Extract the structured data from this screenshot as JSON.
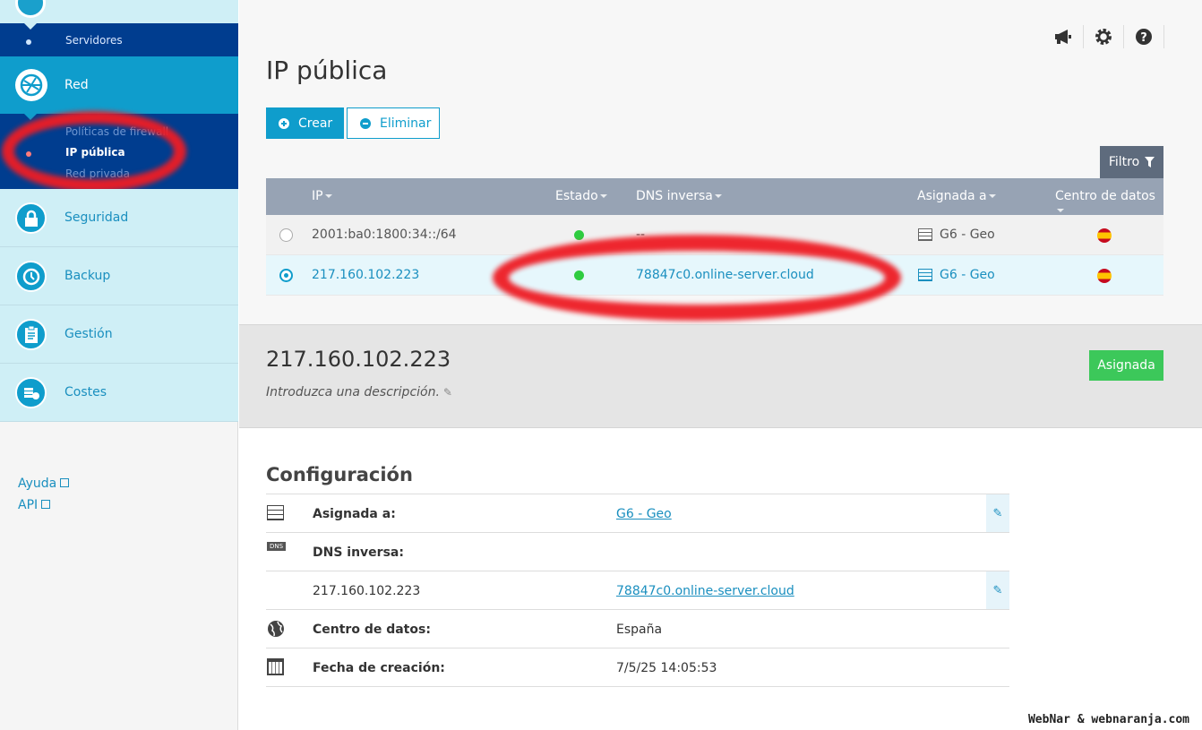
{
  "sidebar": {
    "servers_label": "Servidores",
    "red_label": "Red",
    "sub_items": [
      {
        "label": "Políticas de firewall",
        "active": false
      },
      {
        "label": "IP pública",
        "active": true
      },
      {
        "label": "Red privada",
        "active": false
      }
    ],
    "items": [
      {
        "label": "Seguridad",
        "icon": "lock-icon"
      },
      {
        "label": "Backup",
        "icon": "clock-history-icon"
      },
      {
        "label": "Gestión",
        "icon": "clipboard-icon"
      },
      {
        "label": "Costes",
        "icon": "coins-icon"
      }
    ],
    "links": [
      {
        "label": "Ayuda"
      },
      {
        "label": "API"
      }
    ]
  },
  "header": {
    "title": "IP pública",
    "icons": [
      "megaphone-icon",
      "gear-icon",
      "help-icon"
    ]
  },
  "toolbar": {
    "create_label": "Crear",
    "delete_label": "Eliminar",
    "filter_label": "Filtro"
  },
  "table": {
    "columns": [
      "IP",
      "Estado",
      "DNS inversa",
      "Asignada a",
      "Centro de datos"
    ],
    "rows": [
      {
        "ip": "2001:ba0:1800:34::/64",
        "status": "active",
        "dns": "--",
        "assigned": "G6 - Geo",
        "selected": false
      },
      {
        "ip": "217.160.102.223",
        "status": "active",
        "dns": "78847c0.online-server.cloud",
        "assigned": "G6 - Geo",
        "selected": true
      }
    ],
    "status_color": "#2ecc40"
  },
  "detail": {
    "ip": "217.160.102.223",
    "description_placeholder": "Introduzca una descripción.",
    "badge": "Asignada"
  },
  "config": {
    "title": "Configuración",
    "assigned_label": "Asignada a:",
    "assigned_value": "G6 - Geo",
    "dns_label": "DNS inversa:",
    "dns_ip": "217.160.102.223",
    "dns_value": "78847c0.online-server.cloud",
    "datacenter_label": "Centro de datos:",
    "datacenter_value": "España",
    "created_label": "Fecha de creación:",
    "created_value": "7/5/25 14:05:53"
  },
  "watermark": "WebNar & webnaranja.com",
  "colors": {
    "accent": "#0f9dcc",
    "nav_dark": "#003d8f",
    "success": "#3cc85a",
    "annotation": "#ee1c24"
  }
}
